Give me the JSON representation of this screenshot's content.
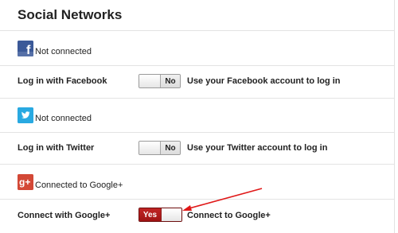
{
  "section_title": "Social Networks",
  "facebook": {
    "icon": "facebook-icon",
    "status": "Not connected",
    "row_label": "Log in with Facebook",
    "toggle_state": "No",
    "description": "Use your Facebook account to log in",
    "color": "#3b5998"
  },
  "twitter": {
    "icon": "twitter-icon",
    "status": "Not connected",
    "row_label": "Log in with Twitter",
    "toggle_state": "No",
    "description": "Use your Twitter account to log in",
    "color": "#29a9e1"
  },
  "google": {
    "icon": "google-plus-icon",
    "status": "Connected to Google+",
    "row_label": "Connect with Google+",
    "toggle_state": "Yes",
    "description": "Connect to Google+",
    "color": "#d34836"
  },
  "annotation": {
    "arrow_color": "#e01818"
  }
}
